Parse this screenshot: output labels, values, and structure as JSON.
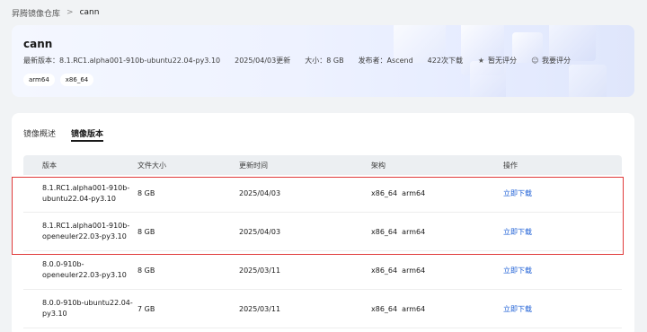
{
  "breadcrumb": {
    "root": "昇腾镜像仓库",
    "current": "cann"
  },
  "hero": {
    "title": "cann",
    "latest_version": "最新版本：8.1.RC1.alpha001-910b-ubuntu22.04-py3.10",
    "updated": "2025/04/03更新",
    "size": "大小：8 GB",
    "publisher": "发布者：Ascend",
    "downloads": "422次下载",
    "rating": "暂无评分",
    "rate_action": "我要评分",
    "tags": [
      "arm64",
      "x86_64"
    ]
  },
  "tabs": [
    {
      "label": "镜像概述",
      "active": false
    },
    {
      "label": "镜像版本",
      "active": true
    }
  ],
  "table": {
    "columns": [
      "版本",
      "文件大小",
      "更新时间",
      "架构",
      "操作"
    ],
    "rows": [
      {
        "version_1": "8.1.RC1.alpha001-910b-",
        "version_2": "ubuntu22.04-py3.10",
        "size": "8 GB",
        "date": "2025/04/03",
        "arch": "x86_64  arm64",
        "action": "立即下载"
      },
      {
        "version_1": "8.1.RC1.alpha001-910b-",
        "version_2": "openeuler22.03-py3.10",
        "size": "8 GB",
        "date": "2025/04/03",
        "arch": "x86_64  arm64",
        "action": "立即下载"
      },
      {
        "version_1": "8.0.0-910b-",
        "version_2": "openeuler22.03-py3.10",
        "size": "8 GB",
        "date": "2025/03/11",
        "arch": "x86_64  arm64",
        "action": "立即下载"
      },
      {
        "version_1": "8.0.0-910b-ubuntu22.04-",
        "version_2": "py3.10",
        "size": "7 GB",
        "date": "2025/03/11",
        "arch": "x86_64  arm64",
        "action": "立即下载"
      }
    ]
  },
  "colors": {
    "link": "#1d5fd6",
    "highlight": "#e03a3a",
    "header_bg": "#eceff2",
    "page_bg": "#f1f3f5"
  },
  "icons": {
    "star": "star-icon",
    "rate": "rate-icon",
    "chevron": "chevron-right-icon"
  }
}
